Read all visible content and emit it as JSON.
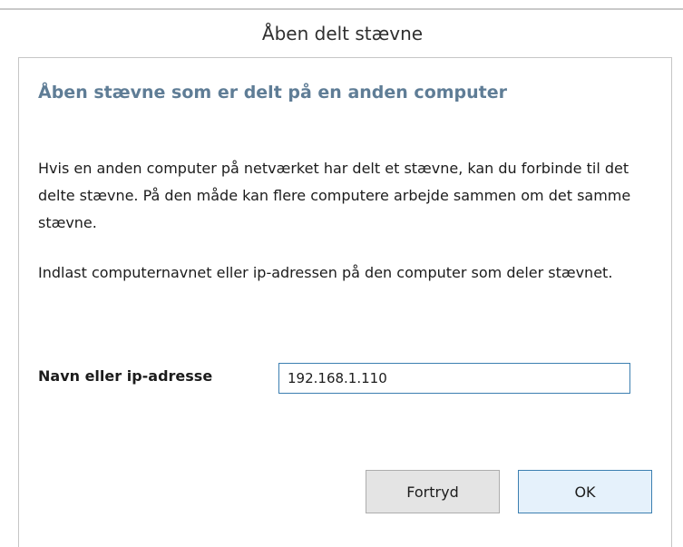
{
  "dialog": {
    "title": "Åben delt stævne",
    "heading": "Åben stævne som er delt på en anden computer",
    "paragraphs": {
      "intro": "Hvis en anden computer på netværket har delt et stævne, kan du forbinde til det delte stævne. På den måde kan flere computere arbejde sammen om det samme stævne.",
      "instruction": "Indlast computernavnet eller ip-adressen på den computer som deler stævnet."
    },
    "field": {
      "label": "Navn eller ip-adresse",
      "value": "192.168.1.110"
    },
    "buttons": {
      "cancel_label": "Fortryd",
      "ok_label": "OK"
    }
  }
}
